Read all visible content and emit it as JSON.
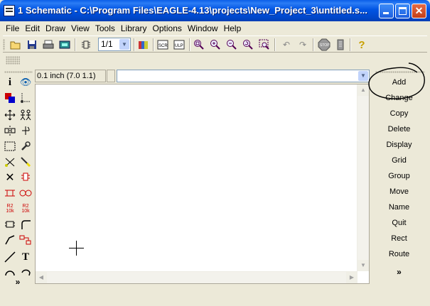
{
  "window": {
    "title": "1 Schematic - C:\\Program Files\\EAGLE-4.13\\projects\\New_Project_3\\untitled.s..."
  },
  "menubar": {
    "items": [
      {
        "label": "File"
      },
      {
        "label": "Edit"
      },
      {
        "label": "Draw"
      },
      {
        "label": "View"
      },
      {
        "label": "Tools"
      },
      {
        "label": "Library"
      },
      {
        "label": "Options"
      },
      {
        "label": "Window"
      },
      {
        "label": "Help"
      }
    ]
  },
  "toolbar": {
    "sheet_value": "1/1"
  },
  "coordinates": {
    "grid_readout": "0.1 inch (7.0 1.1)"
  },
  "command_line": {
    "value": ""
  },
  "command_menu": {
    "items": [
      "Add",
      "Change",
      "Copy",
      "Delete",
      "Display",
      "Grid",
      "Group",
      "Move",
      "Name",
      "Quit",
      "Rect",
      "Route"
    ],
    "more_glyph": "»"
  },
  "palette": {
    "text_tool_glyph": "T",
    "name_label": "R2",
    "value_label": "10k"
  },
  "colors": {
    "titlebar": "#0054e3",
    "chrome": "#ece9d8",
    "canvas": "#ffffff"
  }
}
